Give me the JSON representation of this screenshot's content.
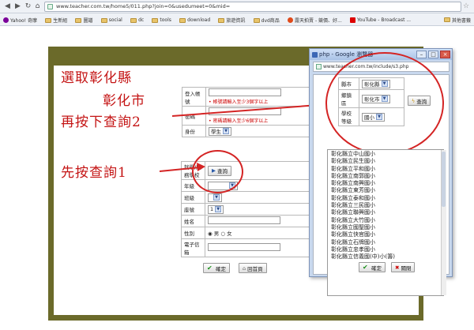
{
  "browser": {
    "url": "www.teacher.com.tw/home5/011.php?join=0&usedumeet=0&mid=",
    "bookmarks": [
      "Yahoo! 奇摩",
      "生新組",
      "圖譜",
      "social",
      "dc",
      "tools",
      "download",
      "旅遊資訊",
      "dvd商品",
      "露天拍賣 - 競價、好...",
      "YouTube - Broadcast ..."
    ],
    "other_bookmarks": "其他書籤"
  },
  "annotations": {
    "line1": "選取彰化縣",
    "line2": "彰化市",
    "line3": "再按下查詢2",
    "line4": "先按查詢1"
  },
  "form": {
    "login_label": "登入帳號",
    "login_warning": "帳號請輸入至少3個字以上",
    "password_label": "密碼",
    "password_warning": "密碼請輸入至少6個字以上",
    "identity_label": "身份",
    "identity_value": "學生",
    "school_label": "就學/服務學校",
    "query_button": "查詢",
    "grade_label": "年級",
    "class_label": "班級",
    "seat_label": "座號",
    "seat_value": "1",
    "name_label": "姓名",
    "gender_label": "性別",
    "gender_male": "男",
    "gender_female": "女",
    "email_label": "電子信箱",
    "confirm_button": "確定",
    "home_button": "回首頁"
  },
  "popup": {
    "title": "php - Google 瀏覽器",
    "url": "www.teacher.com.tw/include/s3.php",
    "county_label": "縣市",
    "county_value": "彰化縣",
    "district_label": "鄉鎮區",
    "district_value": "彰化市",
    "level_label": "學校等級",
    "level_value": "國小",
    "query_button": "查詢",
    "schools": [
      "彰化縣立中山國小",
      "彰化縣立民生國小",
      "彰化縣立平和國小",
      "彰化縣立南郭國小",
      "彰化縣立南興國小",
      "彰化縣立東芳國小",
      "彰化縣立泰和國小",
      "彰化縣立三民國小",
      "彰化縣立聯興國小",
      "彰化縣立大竹國小",
      "彰化縣立國聖國小",
      "彰化縣立快官國小",
      "彰化縣立石牌國小",
      "彰化縣立忠孝國小",
      "彰化縣立信義國(中)小(籌)"
    ],
    "confirm_button": "確定",
    "close_button": "關閉"
  }
}
